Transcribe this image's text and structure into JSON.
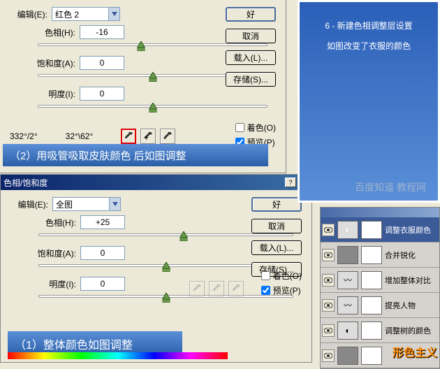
{
  "dialog1": {
    "edit_label": "编辑(E):",
    "edit_value": "红色 2",
    "hue_label": "色相(H):",
    "hue_value": "-16",
    "sat_label": "饱和度(A):",
    "sat_value": "0",
    "light_label": "明度(I):",
    "light_value": "0",
    "deg1": "332°/2°",
    "deg2": "32°\\62°",
    "ok": "好",
    "cancel": "取消",
    "load": "载入(L)...",
    "save": "存储(S)...",
    "colorize": "着色(O)",
    "preview": "预览(P)",
    "caption": "（2）用吸管吸取皮肤颜色 后如图调整"
  },
  "dialog2": {
    "title": "色相/饱和度",
    "edit_label": "编辑(E):",
    "edit_value": "全图",
    "hue_label": "色相(H):",
    "hue_value": "+25",
    "sat_label": "饱和度(A):",
    "sat_value": "0",
    "light_label": "明度(I):",
    "light_value": "0",
    "ok": "好",
    "cancel": "取消",
    "load": "载入(L)...",
    "save": "存储(S)...",
    "colorize": "着色(O)",
    "preview": "预览(P)",
    "caption": "（1）整体颜色如图调整"
  },
  "banner": {
    "line1": "6 - 新建色相调整层设置",
    "line2": "如图改变了衣服的颜色"
  },
  "layers": {
    "items": [
      {
        "name": "调整衣服颜色",
        "type": "adj",
        "selected": true
      },
      {
        "name": "合并锐化",
        "type": "img"
      },
      {
        "name": "增加整体对比",
        "type": "curves"
      },
      {
        "name": "提亮人物",
        "type": "curves"
      },
      {
        "name": "调整树的颜色",
        "type": "adj"
      },
      {
        "name": "",
        "type": "img"
      }
    ]
  },
  "watermark": "百度知道 教程网",
  "logo": "形色主义"
}
